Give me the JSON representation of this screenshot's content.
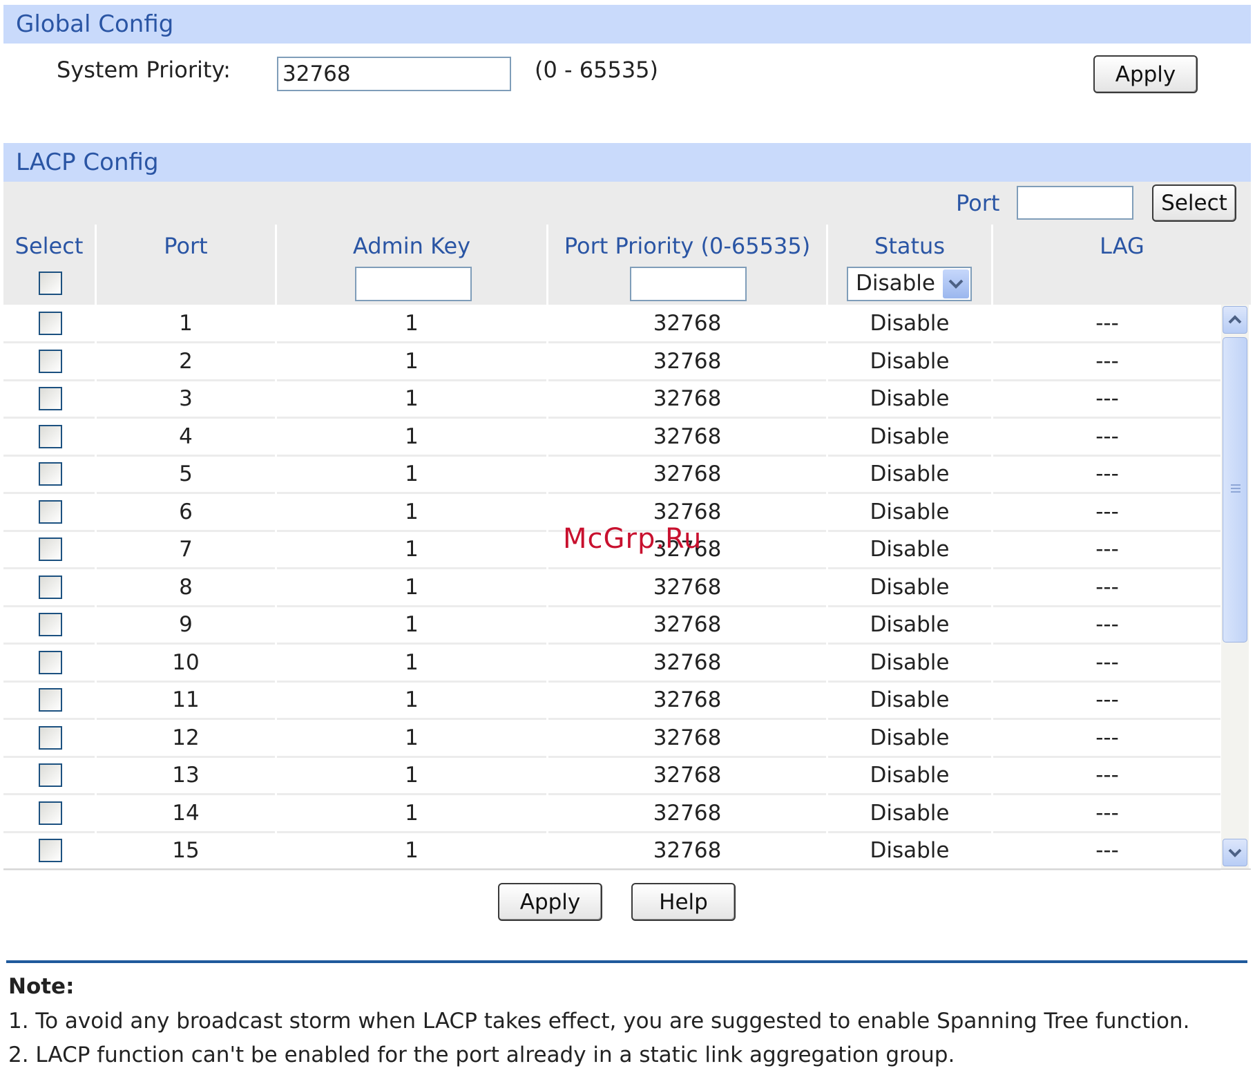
{
  "global_config": {
    "title": "Global Config",
    "system_priority_label": "System Priority:",
    "system_priority_value": "32768",
    "range_hint": "(0 - 65535)",
    "apply_label": "Apply"
  },
  "lacp_config": {
    "title": "LACP Config",
    "port_filter_label": "Port",
    "port_filter_value": "",
    "select_button_label": "Select",
    "columns": [
      "Select",
      "Port",
      "Admin Key",
      "Port Priority (0-65535)",
      "Status",
      "LAG"
    ],
    "batch_status_value": "Disable",
    "rows": [
      {
        "port": "1",
        "admin_key": "1",
        "priority": "32768",
        "status": "Disable",
        "lag": "---"
      },
      {
        "port": "2",
        "admin_key": "1",
        "priority": "32768",
        "status": "Disable",
        "lag": "---"
      },
      {
        "port": "3",
        "admin_key": "1",
        "priority": "32768",
        "status": "Disable",
        "lag": "---"
      },
      {
        "port": "4",
        "admin_key": "1",
        "priority": "32768",
        "status": "Disable",
        "lag": "---"
      },
      {
        "port": "5",
        "admin_key": "1",
        "priority": "32768",
        "status": "Disable",
        "lag": "---"
      },
      {
        "port": "6",
        "admin_key": "1",
        "priority": "32768",
        "status": "Disable",
        "lag": "---"
      },
      {
        "port": "7",
        "admin_key": "1",
        "priority": "32768",
        "status": "Disable",
        "lag": "---"
      },
      {
        "port": "8",
        "admin_key": "1",
        "priority": "32768",
        "status": "Disable",
        "lag": "---"
      },
      {
        "port": "9",
        "admin_key": "1",
        "priority": "32768",
        "status": "Disable",
        "lag": "---"
      },
      {
        "port": "10",
        "admin_key": "1",
        "priority": "32768",
        "status": "Disable",
        "lag": "---"
      },
      {
        "port": "11",
        "admin_key": "1",
        "priority": "32768",
        "status": "Disable",
        "lag": "---"
      },
      {
        "port": "12",
        "admin_key": "1",
        "priority": "32768",
        "status": "Disable",
        "lag": "---"
      },
      {
        "port": "13",
        "admin_key": "1",
        "priority": "32768",
        "status": "Disable",
        "lag": "---"
      },
      {
        "port": "14",
        "admin_key": "1",
        "priority": "32768",
        "status": "Disable",
        "lag": "---"
      },
      {
        "port": "15",
        "admin_key": "1",
        "priority": "32768",
        "status": "Disable",
        "lag": "---"
      }
    ],
    "apply_label": "Apply",
    "help_label": "Help"
  },
  "watermark": "McGrp.Ru",
  "note": {
    "title": "Note:",
    "lines": [
      "1. To avoid any broadcast storm when LACP takes effect, you are suggested to enable Spanning Tree function.",
      "2. LACP function can't be enabled for the port already in a static link aggregation group."
    ]
  },
  "colors": {
    "header_bg": "#c9dafb",
    "header_text": "#2a55a4",
    "divider": "#1f5a9c",
    "watermark": "#c8102e"
  },
  "icons": {
    "dropdown": "chevron-down-icon",
    "scroll_up": "scroll-up-arrow-icon",
    "scroll_down": "scroll-down-arrow-icon"
  }
}
